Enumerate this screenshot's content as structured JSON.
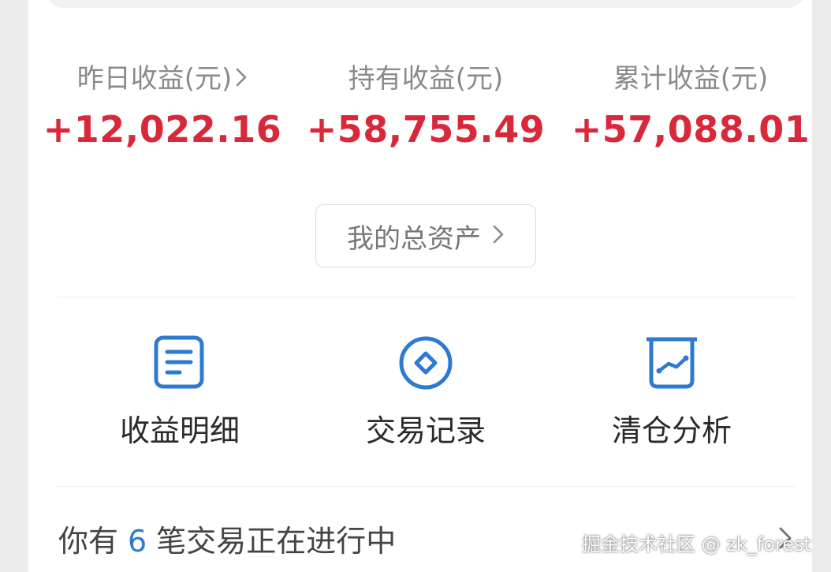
{
  "stats": [
    {
      "label": "昨日收益(元)",
      "value": "+12,022.16",
      "has_arrow": true
    },
    {
      "label": "持有收益(元)",
      "value": "+58,755.49",
      "has_arrow": false
    },
    {
      "label": "累计收益(元)",
      "value": "+57,088.01",
      "has_arrow": false
    }
  ],
  "assets_button": {
    "label": "我的总资产",
    "icon": "chevron-right-icon"
  },
  "actions": [
    {
      "label": "收益明细",
      "icon": "document-icon"
    },
    {
      "label": "交易记录",
      "icon": "diamond-circle-icon"
    },
    {
      "label": "清仓分析",
      "icon": "trend-chart-icon"
    }
  ],
  "footer": {
    "prefix": "你有",
    "count": "6",
    "suffix": "笔交易正在进行中",
    "icon": "chevron-right-icon"
  },
  "watermark": "掘金技术社区 @ zk_forest",
  "colors": {
    "positive": "#d9283a",
    "accent": "#2e7ad1",
    "icon_blue": "#2e7ad1",
    "label_gray": "#8a8a8a"
  }
}
